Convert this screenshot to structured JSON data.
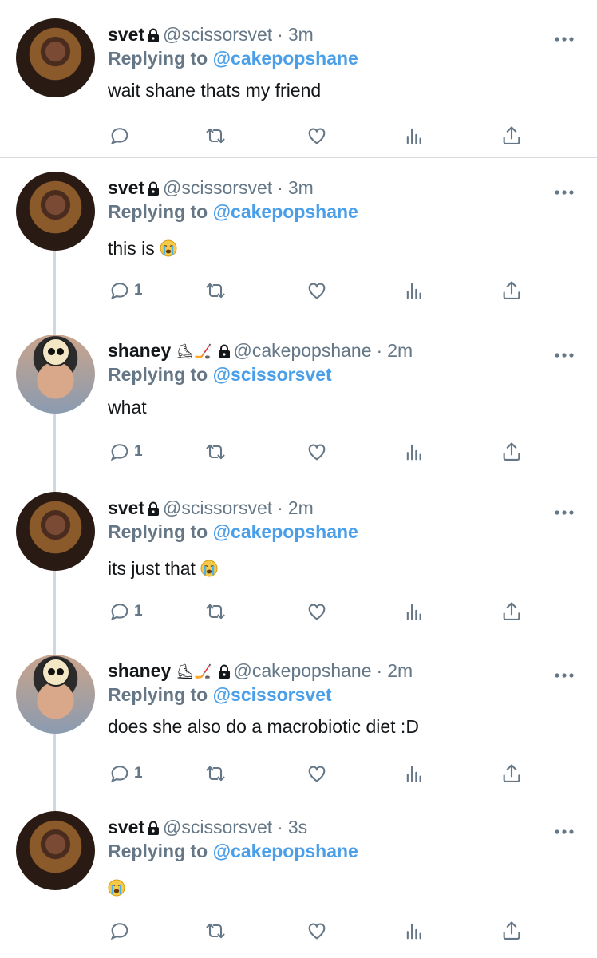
{
  "tweets": [
    {
      "kind": "svet",
      "name": "svet",
      "handle": "@scissorsvet",
      "dot": "·",
      "time": "3m",
      "reply_prefix": "Replying to",
      "reply_to": "@cakepopshane",
      "text": "wait shane thats my friend",
      "has_emoji": false,
      "reply_count": ""
    },
    {
      "kind": "svet",
      "name": "svet",
      "handle": "@scissorsvet",
      "dot": "·",
      "time": "3m",
      "reply_prefix": "Replying to",
      "reply_to": "@cakepopshane",
      "text": "this is",
      "has_emoji": true,
      "reply_count": "1"
    },
    {
      "kind": "shaney",
      "name": "shaney",
      "name_emoji": "⛸🏒",
      "handle": "@cakepopshane",
      "dot": "·",
      "time": "2m",
      "reply_prefix": "Replying to",
      "reply_to": "@scissorsvet",
      "text": "what",
      "has_emoji": false,
      "reply_count": "1"
    },
    {
      "kind": "svet",
      "name": "svet",
      "handle": "@scissorsvet",
      "dot": "·",
      "time": "2m",
      "reply_prefix": "Replying to",
      "reply_to": "@cakepopshane",
      "text": "its just that",
      "has_emoji": true,
      "reply_count": "1"
    },
    {
      "kind": "shaney",
      "name": "shaney",
      "name_emoji": "⛸🏒",
      "handle": "@cakepopshane",
      "dot": "·",
      "time": "2m",
      "reply_prefix": "Replying to",
      "reply_to": "@scissorsvet",
      "text": "does she also do a macrobiotic diet :D",
      "has_emoji": false,
      "reply_count": "1"
    },
    {
      "kind": "svet",
      "name": "svet",
      "handle": "@scissorsvet",
      "dot": "·",
      "time": "3s",
      "reply_prefix": "Replying to",
      "reply_to": "@cakepopshane",
      "text": "",
      "has_emoji": true,
      "reply_count": ""
    }
  ],
  "icons": {
    "reply": "reply-icon",
    "retweet": "retweet-icon",
    "like": "heart-icon",
    "analytics": "analytics-icon",
    "share": "share-icon",
    "more": "more-icon",
    "lock": "lock-icon",
    "emoji": "loudly-crying-face-icon"
  },
  "colors": {
    "accent": "#4a9fe8",
    "muted": "#657786",
    "text": "#14171a",
    "divider": "#d6dbdf"
  }
}
